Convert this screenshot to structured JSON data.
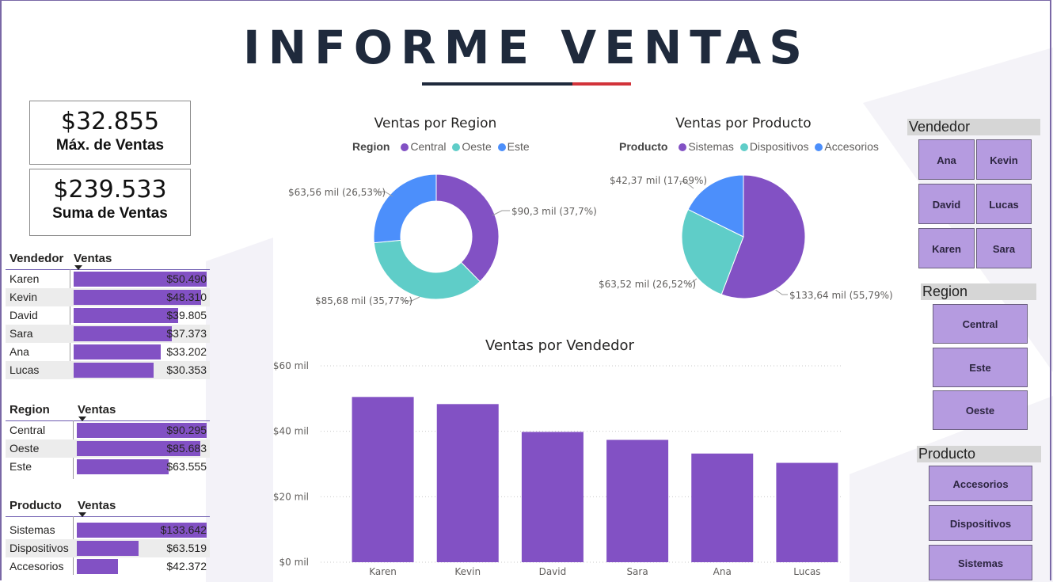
{
  "report": {
    "title": "INFORME VENTAS"
  },
  "colors": {
    "purple": "#8251c4",
    "teal": "#5fcdc8",
    "blue": "#4c8ffb",
    "slicer": "#b59be0",
    "title": "#1f2a3c",
    "accent_red": "#d2333a"
  },
  "kpis": [
    {
      "value": "$32.855",
      "label": "Máx. de Ventas"
    },
    {
      "value": "$239.533",
      "label": "Suma de Ventas"
    }
  ],
  "tables": {
    "vendedor": {
      "col1": "Vendedor",
      "col2": "Ventas",
      "rows": [
        {
          "name": "Karen",
          "value": "$50.490",
          "amount": 50490
        },
        {
          "name": "Kevin",
          "value": "$48.310",
          "amount": 48310
        },
        {
          "name": "David",
          "value": "$39.805",
          "amount": 39805
        },
        {
          "name": "Sara",
          "value": "$37.373",
          "amount": 37373
        },
        {
          "name": "Ana",
          "value": "$33.202",
          "amount": 33202
        },
        {
          "name": "Lucas",
          "value": "$30.353",
          "amount": 30353
        }
      ]
    },
    "region": {
      "col1": "Region",
      "col2": "Ventas",
      "rows": [
        {
          "name": "Central",
          "value": "$90.295",
          "amount": 90295
        },
        {
          "name": "Oeste",
          "value": "$85.683",
          "amount": 85683
        },
        {
          "name": "Este",
          "value": "$63.555",
          "amount": 63555
        }
      ]
    },
    "producto": {
      "col1": "Producto",
      "col2": "Ventas",
      "rows": [
        {
          "name": "Sistemas",
          "value": "$133.642",
          "amount": 133642
        },
        {
          "name": "Dispositivos",
          "value": "$63.519",
          "amount": 63519
        },
        {
          "name": "Accesorios",
          "value": "$42.372",
          "amount": 42372
        }
      ]
    }
  },
  "chart_data": [
    {
      "type": "pie",
      "variant": "donut",
      "title": "Ventas por Region",
      "legend_title": "Region",
      "legend_position": "top",
      "slices": [
        {
          "name": "Central",
          "value": 90.3,
          "pct": 37.7,
          "label": "$90,3 mil (37,7%)",
          "color": "#8251c4"
        },
        {
          "name": "Oeste",
          "value": 85.68,
          "pct": 35.77,
          "label": "$85,68 mil (35,77%)",
          "color": "#5fcdc8"
        },
        {
          "name": "Este",
          "value": 63.56,
          "pct": 26.53,
          "label": "$63,56 mil (26,53%)",
          "color": "#4c8ffb"
        }
      ]
    },
    {
      "type": "pie",
      "title": "Ventas por Producto",
      "legend_title": "Producto",
      "legend_position": "top",
      "slices": [
        {
          "name": "Sistemas",
          "value": 133.64,
          "pct": 55.79,
          "label": "$133,64 mil (55,79%)",
          "color": "#8251c4"
        },
        {
          "name": "Dispositivos",
          "value": 63.52,
          "pct": 26.52,
          "label": "$63,52 mil (26,52%)",
          "color": "#5fcdc8"
        },
        {
          "name": "Accesorios",
          "value": 42.37,
          "pct": 17.69,
          "label": "$42,37 mil (17,69%)",
          "color": "#4c8ffb"
        }
      ]
    },
    {
      "type": "bar",
      "title": "Ventas por Vendedor",
      "categories": [
        "Karen",
        "Kevin",
        "David",
        "Sara",
        "Ana",
        "Lucas"
      ],
      "values": [
        50490,
        48310,
        39805,
        37373,
        33202,
        30353
      ],
      "ylim": [
        0,
        60000
      ],
      "yticks": [
        {
          "value": 0,
          "label": "$0 mil"
        },
        {
          "value": 20000,
          "label": "$20 mil"
        },
        {
          "value": 40000,
          "label": "$40 mil"
        },
        {
          "value": 60000,
          "label": "$60 mil"
        }
      ],
      "grid": true,
      "color": "#8251c4"
    }
  ],
  "slicers": {
    "vendedor": {
      "title": "Vendedor",
      "items": [
        "Ana",
        "Kevin",
        "David",
        "Lucas",
        "Karen",
        "Sara"
      ]
    },
    "region": {
      "title": "Region",
      "items": [
        "Central",
        "Este",
        "Oeste"
      ]
    },
    "producto": {
      "title": "Producto",
      "items": [
        "Accesorios",
        "Dispositivos",
        "Sistemas"
      ]
    }
  }
}
